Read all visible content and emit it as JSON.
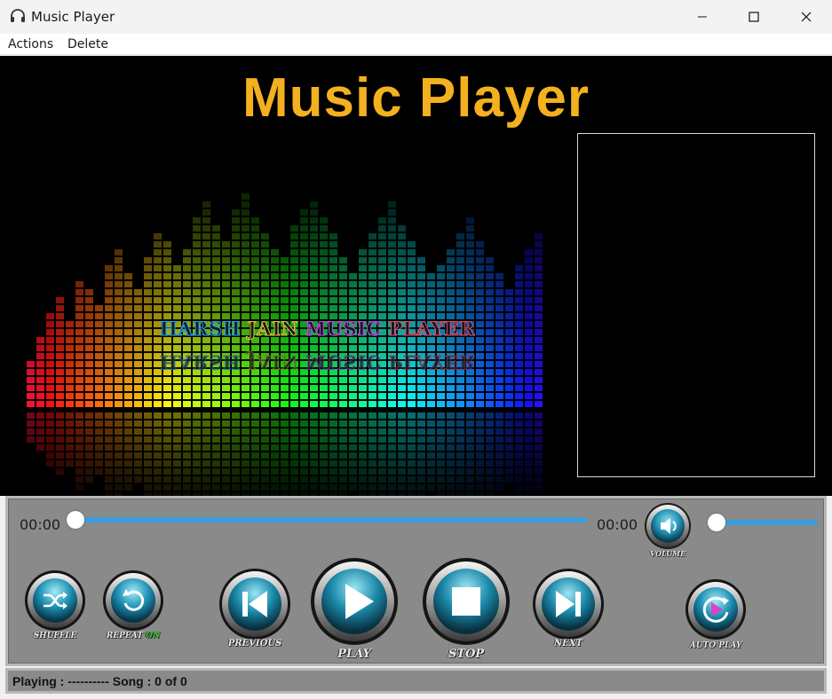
{
  "window": {
    "title": "Music Player",
    "icon": "headphones-icon"
  },
  "menu": {
    "items": [
      "Actions",
      "Delete"
    ]
  },
  "stage": {
    "brand_title": "Music Player",
    "equalizer_caption": {
      "word1": "HARSH ",
      "word2": "JAIN ",
      "word3": "MUSIC ",
      "word4": "PLAYER"
    }
  },
  "seek": {
    "current_time": "00:00",
    "total_time": "00:00",
    "progress": 0
  },
  "volume": {
    "label": "VOLUME",
    "level": 0
  },
  "buttons": {
    "shuffle": "SHUFFLE",
    "repeat": "REPEAT",
    "repeat_state": "ON",
    "previous": "PREVIOUS",
    "play": "PLAY",
    "stop": "STOP",
    "next": "NEXT",
    "auto_play": "AUTO PLAY"
  },
  "status": {
    "text": "Playing : ---------- Song : 0 of 0"
  },
  "colors": {
    "brand": "#f3b01f",
    "accent": "#3a9de0",
    "repeat_on": "#22cc22"
  }
}
